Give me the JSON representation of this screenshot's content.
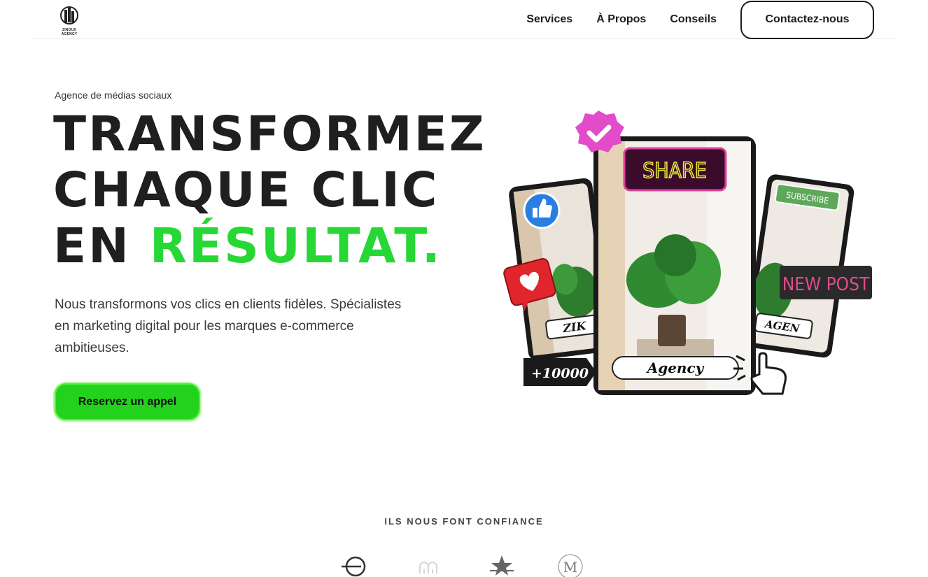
{
  "header": {
    "logo_text": "ZINOUX AGENCY",
    "nav": [
      "Services",
      "À Propos",
      "Conseils"
    ],
    "contact_label": "Contactez-nous"
  },
  "hero": {
    "eyebrow": "Agence de médias sociaux",
    "headline_line1": "TRANSFORMEZ",
    "headline_line2": "CHAQUE CLIC",
    "headline_line3_plain": "EN ",
    "headline_line3_accent": "RÉSULTAT.",
    "subtext": "Nous transformons vos clics en clients fidèles. Spécialistes en marketing digital pour les marques e-commerce ambitieuses.",
    "cta_label": "Reservez un appel"
  },
  "illustration": {
    "share_label": "SHARE",
    "subscribe_label": "SUBSCRIBE",
    "new_post_label": "NEW POST",
    "left_tag": "ZIK",
    "center_tag": "Agency",
    "right_tag": "AGEN",
    "followers": "+10000"
  },
  "trust": {
    "title": "ILS NOUS FONT CONFIANCE",
    "brands": [
      "minimal-line-logo",
      "lotus-logo",
      "star-logo",
      "m-circle-logo"
    ]
  },
  "colors": {
    "accent_green": "#27d735",
    "dark": "#1f1f1f",
    "badge_pink": "#e24bc9",
    "like_blue": "#2a7de1",
    "heart_red": "#e0262c"
  }
}
